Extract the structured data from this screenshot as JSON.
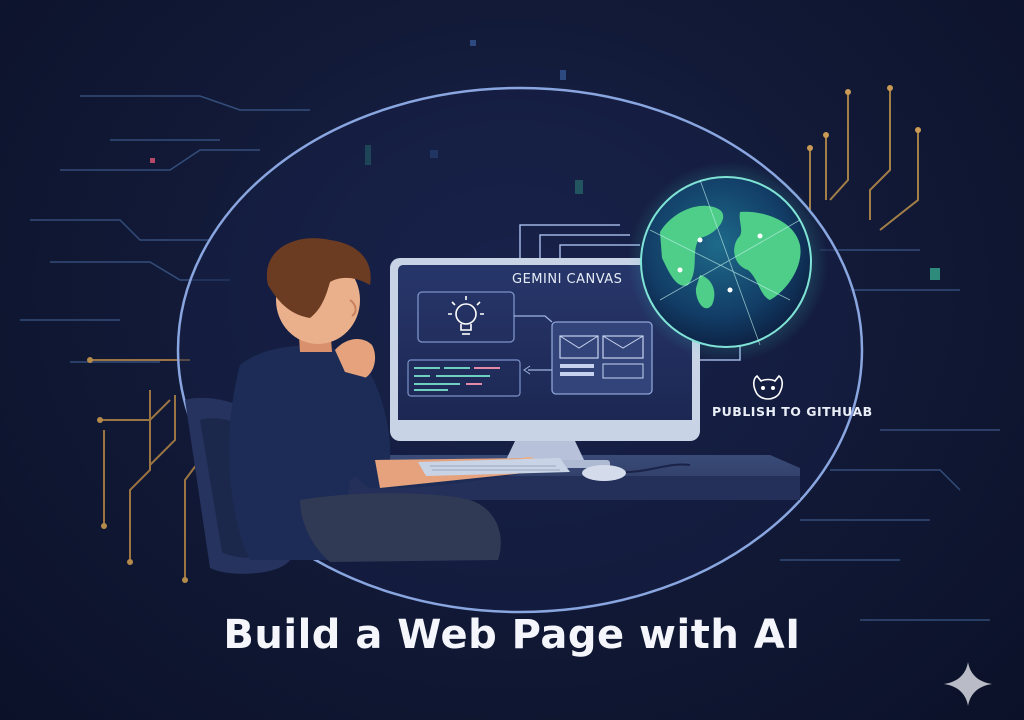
{
  "illustration": {
    "screen_label": "GEMINI CANVAS",
    "publish_label": "PUBLISH TO GITHUAB",
    "icons": [
      "lightbulb-icon",
      "github-cat-icon",
      "globe-icon",
      "sparkle-icon"
    ]
  },
  "title": "Build a Web Page with AI",
  "colors": {
    "background": "#121a38",
    "accent_blue": "#6f8fd6",
    "globe_green": "#47c98c",
    "circuit_gold": "#b58b4c",
    "text": "#f4f6fb"
  }
}
